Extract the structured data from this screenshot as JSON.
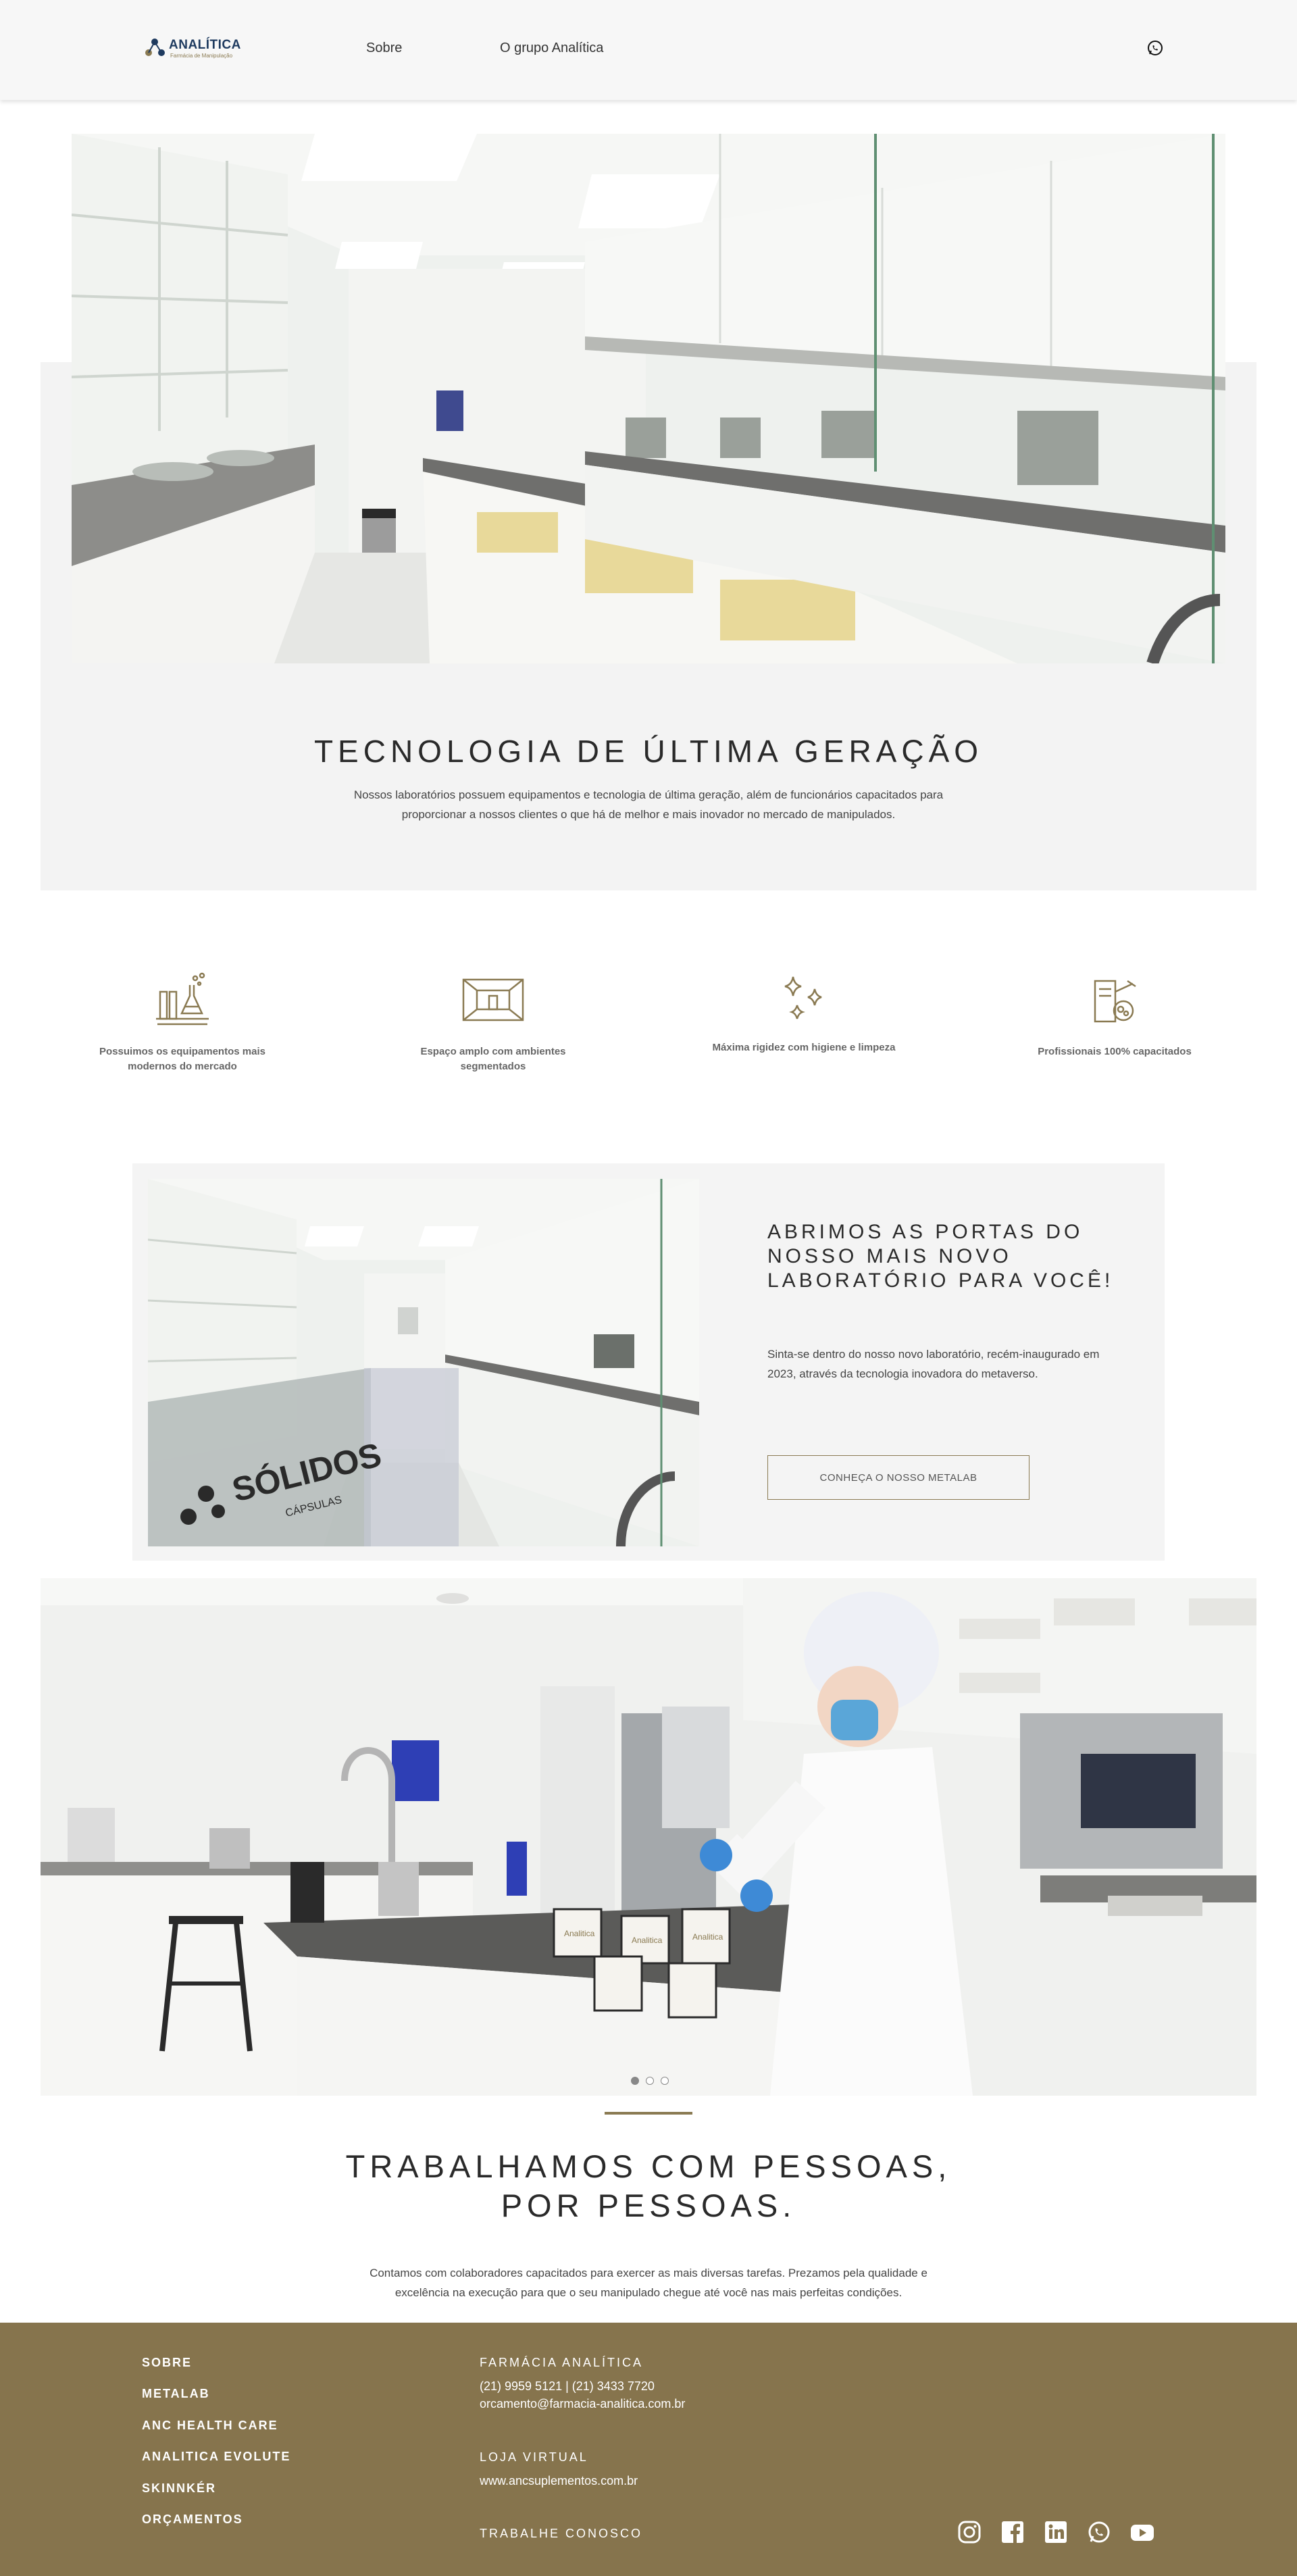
{
  "header": {
    "logo_name": "ANALÍTICA",
    "logo_sub": "Farmácia de Manipulação",
    "nav": [
      "Sobre",
      "O grupo Analítica"
    ],
    "whatsapp_icon": "whatsapp-icon"
  },
  "tech": {
    "title": "TECNOLOGIA DE ÚLTIMA GERAÇÃO",
    "text": "Nossos laboratórios possuem equipamentos e tecnologia de última geração, além de funcionários capacitados para proporcionar a nossos clientes o que há de melhor e mais inovador no mercado de manipulados."
  },
  "features": [
    {
      "icon": "lab-equipment-icon",
      "label": "Possuimos os equipamentos mais modernos do mercado"
    },
    {
      "icon": "room-icon",
      "label": "Espaço amplo com ambientes segmentados"
    },
    {
      "icon": "sparkles-icon",
      "label": "Máxima rigidez com higiene e limpeza"
    },
    {
      "icon": "professional-icon",
      "label": "Profissionais 100% capacitados"
    }
  ],
  "metalab": {
    "title": "ABRIMOS AS PORTAS DO NOSSO MAIS NOVO LABORATÓRIO PARA VOCÊ!",
    "text": "Sinta-se dentro do nosso novo laboratório, recém-inaugurado em 2023, através da tecnologia inovadora do metaverso.",
    "button": "CONHEÇA O NOSSO METALAB",
    "photo_sign_main": "SÓLIDOS",
    "photo_sign_sub": "CÁPSULAS"
  },
  "slider": {
    "slides": 3,
    "active": 1,
    "jar_label": "Analitica"
  },
  "people": {
    "title": "TRABALHAMOS COM PESSOAS, POR PESSOAS.",
    "text": "Contamos com colaboradores capacitados para exercer as mais diversas tarefas. Prezamos pela qualidade e excelência na execução para que o seu manipulado chegue até você nas mais perfeitas condições."
  },
  "footer": {
    "links": [
      "SOBRE",
      "METALAB",
      "ANC HEALTH CARE",
      "ANALITICA EVOLUTE",
      "SKINNKÉR",
      "ORÇAMENTOS"
    ],
    "pharmacy_title": "FARMÁCIA ANALÍTICA",
    "phones": "(21) 9959 5121 | (21) 3433 7720",
    "email": "orcamento@farmacia-analitica.com.br",
    "store_title": "LOJA VIRTUAL",
    "store_url": "www.ancsuplementos.com.br",
    "careers": "TRABALHE CONOSCO",
    "social": [
      "instagram-icon",
      "facebook-icon",
      "linkedin-icon",
      "whatsapp-icon",
      "youtube-icon"
    ]
  },
  "colors": {
    "accent_gold": "#8a7a52",
    "footer_bg": "#86744d",
    "brand_navy": "#1e3a5f",
    "panel_gray": "#f3f3f3"
  }
}
